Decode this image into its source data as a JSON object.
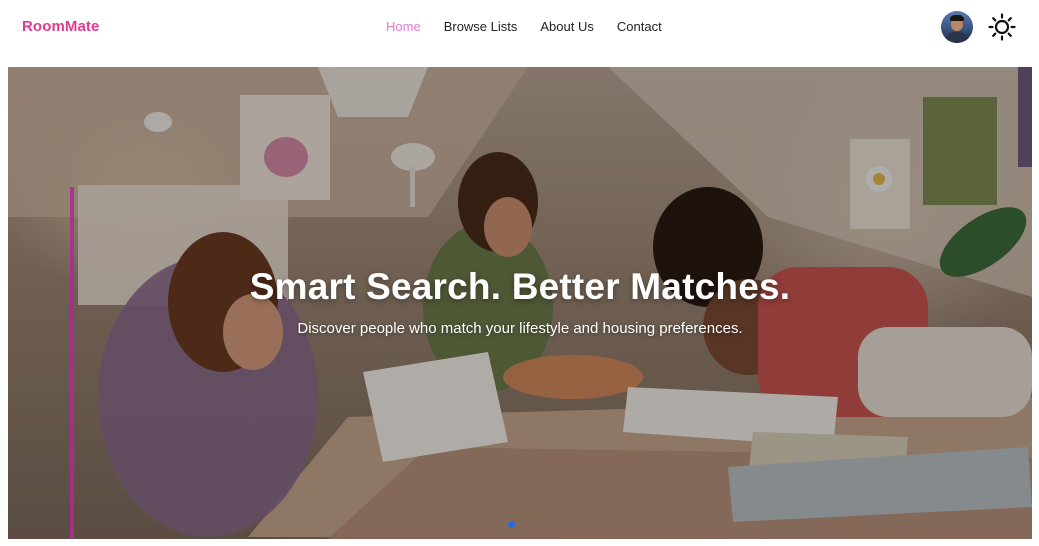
{
  "brand": {
    "name": "RoomMate",
    "color": "#e5398f"
  },
  "nav": {
    "items": [
      {
        "label": "Home",
        "active": true
      },
      {
        "label": "Browse Lists",
        "active": false
      },
      {
        "label": "About Us",
        "active": false
      },
      {
        "label": "Contact",
        "active": false
      }
    ],
    "active_color": "#e27ad0"
  },
  "header_actions": {
    "avatar": "user-avatar",
    "theme_toggle_icon": "sun-icon"
  },
  "hero": {
    "title": "Smart Search. Better Matches.",
    "subtitle": "Discover people who match your lifestyle and housing preferences.",
    "carousel": {
      "slide_count": 1,
      "active_index": 0,
      "active_dot_color": "#1f6fe0"
    }
  }
}
